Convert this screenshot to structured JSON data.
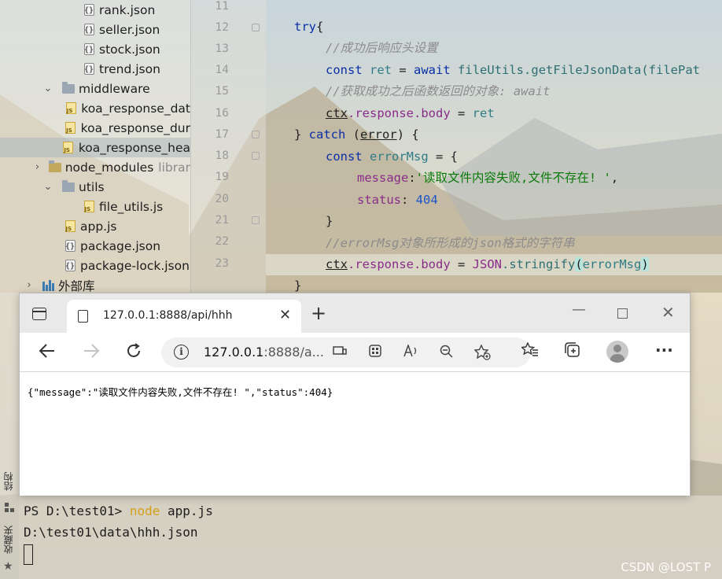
{
  "project_tree": {
    "items": [
      {
        "label": "rank.json",
        "type": "json"
      },
      {
        "label": "seller.json",
        "type": "json"
      },
      {
        "label": "stock.json",
        "type": "json"
      },
      {
        "label": "trend.json",
        "type": "json"
      },
      {
        "label": "middleware",
        "type": "folder",
        "expanded": true
      },
      {
        "label": "koa_response_dat",
        "type": "js"
      },
      {
        "label": "koa_response_dur",
        "type": "js"
      },
      {
        "label": "koa_response_hea",
        "type": "js",
        "selected": true
      },
      {
        "label": "node_modules",
        "suffix": "librar",
        "type": "folder",
        "expanded": false
      },
      {
        "label": "utils",
        "type": "folder",
        "expanded": true
      },
      {
        "label": "file_utils.js",
        "type": "js"
      },
      {
        "label": "app.js",
        "type": "js"
      },
      {
        "label": "package.json",
        "type": "json"
      },
      {
        "label": "package-lock.json",
        "type": "json"
      },
      {
        "label": "外部库",
        "type": "library",
        "expanded": false
      }
    ]
  },
  "editor": {
    "line_numbers": [
      "11",
      "12",
      "13",
      "14",
      "15",
      "16",
      "17",
      "18",
      "19",
      "20",
      "21",
      "22",
      "23"
    ],
    "code": {
      "l12_try": "try",
      "l12_brace": "{",
      "l13_comment": "//成功后响应头设置",
      "l14_const": "const",
      "l14_ret": "ret",
      "l14_eq": " = ",
      "l14_await": "await",
      "l14_fileUtils": "fileUtils",
      "l14_method": ".getFileJsonData",
      "l14_arg": "(filePat",
      "l15_comment": "//获取成功之后函数返回的对象: await",
      "l16_ctx": "ctx",
      "l16_response": ".response",
      "l16_body": ".body",
      "l16_eq": " = ",
      "l16_ret": "ret",
      "l17_close": "} ",
      "l17_catch": "catch",
      "l17_paren_open": " (",
      "l17_error": "error",
      "l17_paren_close": ") {",
      "l18_const": "const",
      "l18_errorMsg": "errorMsg",
      "l18_eq": " = {",
      "l19_key": "message",
      "l19_colon": ":",
      "l19_value": "'读取文件内容失败,文件不存在! '",
      "l19_comma": ",",
      "l20_key": "status",
      "l20_colon": ": ",
      "l20_value": "404",
      "l21_close": "}",
      "l22_comment": "//errorMsg对象所形成的json格式的字符串",
      "l23_ctx": "ctx",
      "l23_response": ".response",
      "l23_body": ".body",
      "l23_eq": " = ",
      "l23_JSON": "JSON",
      "l23_stringify": ".stringify",
      "l23_paren_open": "(",
      "l23_errorMsg": "errorMsg",
      "l23_paren_close": ")",
      "l24_close": "}"
    }
  },
  "browser": {
    "tab_title": "127.0.0.1:8888/api/hhh",
    "tab_close": "✕",
    "new_tab": "+",
    "url_host": "127.0.0.1",
    "url_rest": ":8888/a...",
    "page_text": "{\"message\":\"读取文件内容失败,文件不存在! \",\"status\":404}"
  },
  "side_toolbar": {
    "structure": "结构",
    "favorites": "收藏夹"
  },
  "terminal": {
    "prompt": "PS D:\\test01> ",
    "command": "node",
    "args": " app.js",
    "output": "D:\\test01\\data\\hhh.json"
  },
  "watermark": "CSDN @LOST P",
  "icons": {
    "back": "arrow-left-icon",
    "forward": "arrow-right-icon",
    "refresh": "refresh-icon",
    "info": "info-icon",
    "more": "more-icon"
  }
}
